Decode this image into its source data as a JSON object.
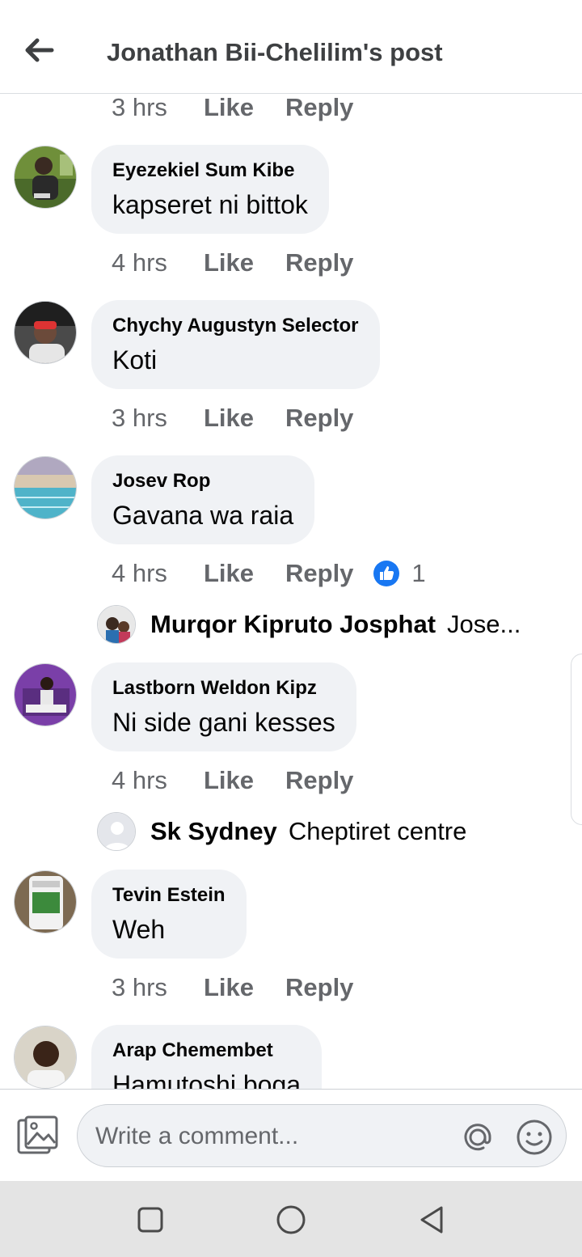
{
  "header": {
    "title": "Jonathan Bii-Chelilim's post",
    "back_icon": "arrow-left-icon"
  },
  "top_meta": {
    "time": "3 hrs",
    "like": "Like",
    "reply": "Reply"
  },
  "comments": [
    {
      "author": "Eyezekiel Sum Kibe",
      "text": "kapseret ni bittok",
      "time": "4 hrs",
      "like": "Like",
      "reply": "Reply"
    },
    {
      "author": "Chychy Augustyn Selector",
      "text": "Koti",
      "time": "3 hrs",
      "like": "Like",
      "reply": "Reply"
    },
    {
      "author": "Josev Rop",
      "text": "Gavana wa raia",
      "time": "4 hrs",
      "like": "Like",
      "reply": "Reply",
      "reaction_count": "1",
      "reply_preview": {
        "name": "Murqor Kipruto Josphat",
        "text": "Jose..."
      }
    },
    {
      "author": "Lastborn Weldon Kipz",
      "text": "Ni side gani kesses",
      "time": "4 hrs",
      "like": "Like",
      "reply": "Reply",
      "reply_preview": {
        "name": "Sk Sydney",
        "text": "Cheptiret centre"
      }
    },
    {
      "author": "Tevin Estein",
      "text": "Weh",
      "time": "3 hrs",
      "like": "Like",
      "reply": "Reply"
    },
    {
      "author": "Arap Chemembet",
      "text": "Hamutoshi boga"
    }
  ],
  "composer": {
    "placeholder": "Write a comment..."
  },
  "colors": {
    "like_blue": "#1877f2",
    "bubble": "#f0f2f5",
    "meta": "#65676b"
  },
  "icons": [
    "arrow-left-icon",
    "thumbs-up-icon",
    "photo-icon",
    "at-icon",
    "emoji-icon",
    "square-icon",
    "circle-icon",
    "triangle-back-icon"
  ]
}
